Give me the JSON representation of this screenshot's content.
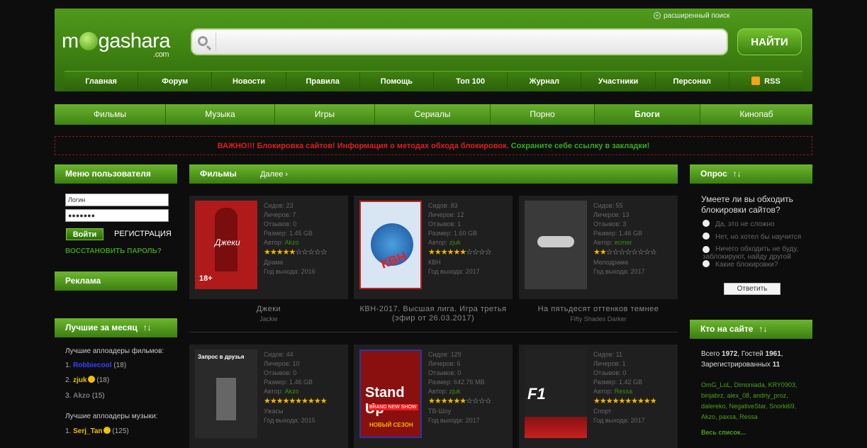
{
  "header": {
    "logo_main": "m",
    "logo_rest": "gashara",
    "logo_com": ".com",
    "advanced_search": "расширенный поиск",
    "search_placeholder": "",
    "find_button": "НАЙТИ",
    "nav": [
      "Главная",
      "Форум",
      "Новости",
      "Правила",
      "Помощь",
      "Топ 100",
      "Журнал",
      "Участники",
      "Персонал",
      "RSS"
    ]
  },
  "categories": [
    "Фильмы",
    "Музыка",
    "Игры",
    "Сериалы",
    "Порно",
    "Блоги",
    "Кинопаб"
  ],
  "alert": {
    "red": "ВАЖНО!!! Блокировка сайтов! Информация о методах обхода блокировок.",
    "green": "Сохраните себе ссылку в закладки!"
  },
  "user_menu": {
    "title": "Меню пользователя",
    "login_value": "Логин",
    "password_value": "●●●●●●●",
    "login_button": "Войти",
    "register": "РЕГИСТРАЦИЯ",
    "restore": "ВОССТАНОВИТЬ ПАРОЛЬ?"
  },
  "ads": {
    "title": "Реклама"
  },
  "best": {
    "title": "Лучшие за месяц",
    "arrows": "↑↓",
    "films_label": "Лучшие аплоадеры фильмов:",
    "films": [
      {
        "n": "1.",
        "name": "Robbiecool",
        "count": "(18)"
      },
      {
        "n": "2.",
        "name": "zjuk",
        "count": "(18)"
      },
      {
        "n": "3.",
        "name": "Akzo",
        "count": "(15)"
      }
    ],
    "music_label": "Лучшие аплоадеры музыки:",
    "music": [
      {
        "n": "1.",
        "name": "Serj_Tan",
        "count": "(125)"
      }
    ]
  },
  "content": {
    "section": "Фильмы",
    "more": "Далее",
    "labels": {
      "seeds": "Сидов:",
      "leech": "Личеров:",
      "reviews": "Отзывов:",
      "size": "Размер:",
      "author": "Автор:",
      "year": "Год выхода:"
    },
    "movies": [
      {
        "title": "Джеки",
        "orig": "Jackie",
        "seeds": "23",
        "leech": "7",
        "reviews": "0",
        "size": "1.45 GB",
        "author": "Akzo",
        "rating": 5,
        "genre": "Драма",
        "year": "2016",
        "poster_color": "#b01a1a"
      },
      {
        "title": "КВН-2017. Высшая лига. Игра третья (эфир от 26.03.2017)",
        "orig": "",
        "seeds": "83",
        "leech": "12",
        "reviews": "1",
        "size": "1.60 GB",
        "author": "zjuk",
        "rating": 6,
        "genre": "КВН",
        "year": "2017",
        "poster_color": "#d7e6f2"
      },
      {
        "title": "На пятьдесят оттенков темнее",
        "orig": "Fifty Shades Darker",
        "seeds": "55",
        "leech": "13",
        "reviews": "3",
        "size": "1.46 GB",
        "author": "ecmer",
        "rating": 2,
        "genre": "Мелодрама",
        "year": "2017",
        "poster_color": "#3a3a3a"
      },
      {
        "title": "",
        "orig": "",
        "seeds": "44",
        "leech": "10",
        "reviews": "0",
        "size": "1.46 GB",
        "author": "Akzo",
        "rating": 10,
        "genre": "Ужасы",
        "year": "2015",
        "poster_color": "#2a2a2a"
      },
      {
        "title": "",
        "orig": "",
        "seeds": "129",
        "leech": "6",
        "reviews": "0",
        "size": "642.76 MB",
        "author": "zjuk",
        "rating": 6,
        "genre": "ТВ-Шоу",
        "year": "2017",
        "poster_color": "#8a1010"
      },
      {
        "title": "",
        "orig": "",
        "seeds": "11",
        "leech": "1",
        "reviews": "0",
        "size": "1.42 GB",
        "author": "Ressa",
        "rating": 10,
        "genre": "Спорт",
        "year": "2017",
        "poster_color": "#222"
      }
    ],
    "poster_text": {
      "kvn": "КВН",
      "standup_1": "Stand Up",
      "standup_2": "BRAND NEW SHOW",
      "standup_3": "НОВЫЙ СЕЗОН",
      "f1": "F1",
      "zapros": "Запрос в друзья",
      "age": "18+",
      "jackie": "Джеки"
    }
  },
  "poll": {
    "title": "Опрос",
    "arrows": "↑↓",
    "question": "Умеете ли вы обходить блокировки сайтов?",
    "options": [
      "Да, это не сложно",
      "Нет, но хотел бы научится",
      "Ничего обходить не буду, заблокируют, найду другой",
      "Какие блокировки?"
    ],
    "answer": "Ответить"
  },
  "online": {
    "title": "Кто на сайте",
    "arrows": "↑↓",
    "line1_a": "Всего",
    "total": "1972",
    "line1_b": ", Гостей",
    "guests": "1961",
    "line2": "Зарегистрированных",
    "registered": "11",
    "users": [
      "OmG_LoL",
      "Dimoniada",
      "KRY0903",
      "binjabrz",
      "alex_08",
      "andriy_proz",
      "dalereko",
      "NegativeStar",
      "Snorki69",
      "Akzo",
      "paxsa",
      "Ressa"
    ],
    "all": "Весь список..."
  }
}
